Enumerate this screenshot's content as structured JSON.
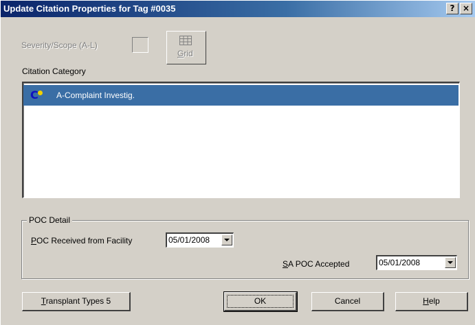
{
  "window": {
    "title": "Update Citation Properties for Tag #0035",
    "help_button": "?",
    "close_button": "×"
  },
  "severity": {
    "label": "Severity/Scope (A-L)",
    "value": ""
  },
  "grid_button": {
    "label_mnemonic": "G",
    "label_rest": "rid"
  },
  "citation_category": {
    "label": "Citation Category",
    "items": [
      {
        "icon": "citation-category-icon",
        "label": "A-Complaint Investig.",
        "selected": true
      }
    ]
  },
  "poc_detail": {
    "title": "POC Detail",
    "received_label_mnemonic": "P",
    "received_label_rest": "OC Received from Facility",
    "received_value": "05/01/2008",
    "accepted_label_prefix": "",
    "accepted_label_mnemonic": "S",
    "accepted_label_rest": "A POC Accepted",
    "accepted_value": "05/01/2008"
  },
  "buttons": {
    "transplant_mnemonic": "T",
    "transplant_rest": "ransplant Types 5",
    "ok": "OK",
    "cancel": "Cancel",
    "help_mnemonic": "H",
    "help_rest": "elp"
  },
  "colors": {
    "titlebar_start": "#0a246a",
    "selection": "#3a6ea5",
    "face": "#d4d0c8"
  }
}
